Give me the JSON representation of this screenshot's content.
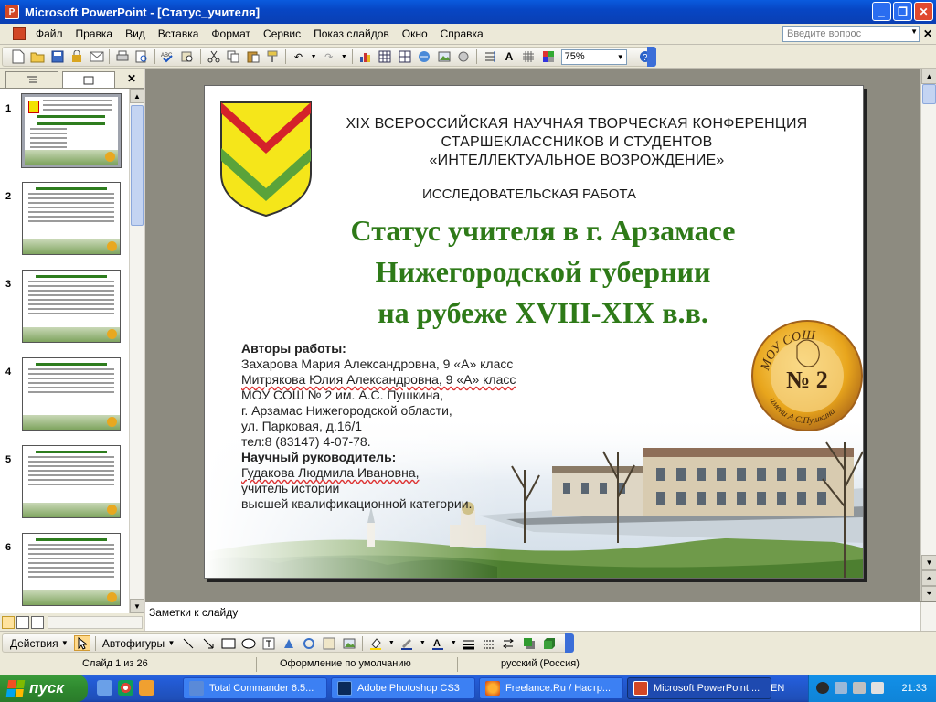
{
  "window": {
    "title": "Microsoft PowerPoint - [Статус_учителя]",
    "app_icon_letter": "P",
    "controls": [
      "minimize",
      "restore",
      "close"
    ]
  },
  "menu": {
    "items": [
      "Файл",
      "Правка",
      "Вид",
      "Вставка",
      "Формат",
      "Сервис",
      "Показ слайдов",
      "Окно",
      "Справка"
    ],
    "help_placeholder": "Введите вопрос"
  },
  "toolbar": {
    "zoom": "75%"
  },
  "left_panel": {
    "tabs": [
      "outline-tab",
      "slides-tab"
    ],
    "slides": [
      {
        "number": "1",
        "selected": true
      },
      {
        "number": "2",
        "selected": false
      },
      {
        "number": "3",
        "selected": false
      },
      {
        "number": "4",
        "selected": false
      },
      {
        "number": "5",
        "selected": false
      },
      {
        "number": "6",
        "selected": false
      }
    ]
  },
  "slide": {
    "conference": [
      "XIX ВСЕРОССИЙСКАЯ НАУЧНАЯ ТВОРЧЕСКАЯ КОНФЕРЕНЦИЯ",
      "СТАРШЕКЛАССНИКОВ И СТУДЕНТОВ",
      "«ИНТЕЛЛЕКТУАЛЬНОЕ ВОЗРОЖДЕНИЕ»"
    ],
    "work_type": "ИССЛЕДОВАТЕЛЬСКАЯ РАБОТА",
    "title_lines": [
      "Статус учителя в г. Арзамасе",
      "Нижегородской губернии",
      "на рубеже XVIII-XIX в.в."
    ],
    "authors_heading": "Авторы работы:",
    "author1": "Захарова Мария Александровна, 9 «А» класс",
    "author2": "Митрякова Юлия Александровна, 9 «А» класс",
    "school_lines": [
      "МОУ СОШ № 2 им. А.С. Пушкина,",
      "г. Арзамас Нижегородской области,",
      "ул. Парковая, д.16/1",
      "тел:8 (83147) 4-07-78."
    ],
    "supervisor_heading": "Научный руководитель:",
    "supervisor_name": "Гудакова Людмила Ивановна,",
    "supervisor_lines": [
      "учитель истории",
      "высшей квалификационной категории."
    ],
    "seal": {
      "top": "МОУ СОШ",
      "number": "№ 2",
      "bottom": "имени А.С.Пушкина"
    },
    "title_color": "#2e7a18"
  },
  "notes": {
    "placeholder": "Заметки к слайду"
  },
  "drawing_toolbar": {
    "actions": "Действия",
    "autoshapes": "Автофигуры"
  },
  "status": {
    "slide": "Слайд 1 из 26",
    "design": "Оформление по умолчанию",
    "language": "русский (Россия)"
  },
  "taskbar": {
    "start": "пуск",
    "tasks": [
      "Total Commander 6.5...",
      "Adobe Photoshop CS3",
      "Freelance.Ru / Настр...",
      "Microsoft PowerPoint ..."
    ],
    "lang": "EN",
    "clock": "21:33"
  }
}
